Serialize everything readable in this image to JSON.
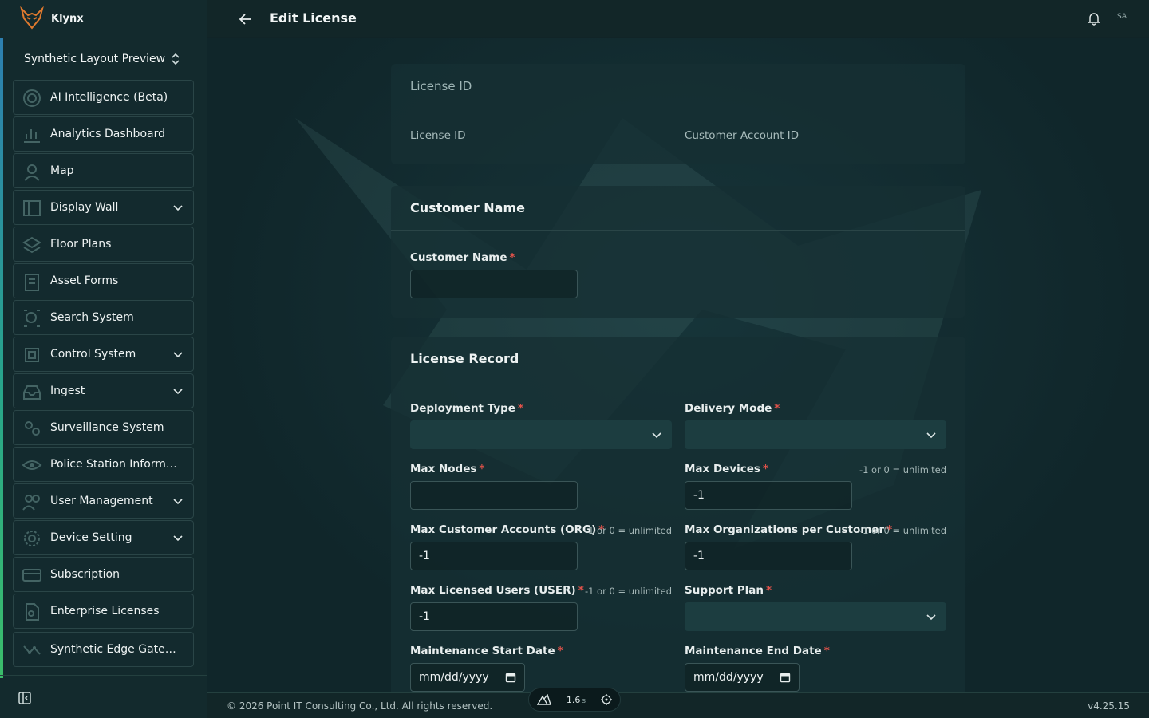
{
  "app": {
    "name": "Klynx"
  },
  "org": {
    "name": "Synthetic Layout Preview"
  },
  "sidebar": {
    "items": [
      {
        "label": "AI Intelligence (Beta)",
        "icon": "radar-icon",
        "expandable": false
      },
      {
        "label": "Analytics Dashboard",
        "icon": "chart-icon",
        "expandable": false
      },
      {
        "label": "Map",
        "icon": "map-pin-icon",
        "expandable": false
      },
      {
        "label": "Display Wall",
        "icon": "display-icon",
        "expandable": true
      },
      {
        "label": "Floor Plans",
        "icon": "layers-icon",
        "expandable": false
      },
      {
        "label": "Asset Forms",
        "icon": "clipboard-icon",
        "expandable": false
      },
      {
        "label": "Search System",
        "icon": "search-icon",
        "expandable": false
      },
      {
        "label": "Control System",
        "icon": "cpu-icon",
        "expandable": true
      },
      {
        "label": "Ingest",
        "icon": "inbox-icon",
        "expandable": true
      },
      {
        "label": "Surveillance System",
        "icon": "camera-icon",
        "expandable": false
      },
      {
        "label": "Police Station Information",
        "icon": "eye-icon",
        "expandable": false
      },
      {
        "label": "User Management",
        "icon": "users-icon",
        "expandable": true
      },
      {
        "label": "Device Setting",
        "icon": "gear-icon",
        "expandable": true
      },
      {
        "label": "Subscription",
        "icon": "card-icon",
        "expandable": false
      },
      {
        "label": "Enterprise Licenses",
        "icon": "license-icon",
        "expandable": false
      },
      {
        "label": "Synthetic Edge Gateway",
        "icon": "gateway-icon",
        "expandable": false
      }
    ]
  },
  "header": {
    "title": "Edit License",
    "user_initials": "SA"
  },
  "license_id_card": {
    "title": "License ID",
    "license_id_label": "License ID",
    "customer_account_id_label": "Customer Account ID"
  },
  "customer_card": {
    "title": "Customer Name",
    "customer_name_label": "Customer Name",
    "customer_name_value": ""
  },
  "record_card": {
    "title": "License Record",
    "deployment_type_label": "Deployment Type",
    "deployment_type_value": "",
    "delivery_mode_label": "Delivery Mode",
    "delivery_mode_value": "",
    "max_nodes_label": "Max Nodes",
    "max_nodes_value": "",
    "max_devices_label": "Max Devices",
    "max_devices_value": "-1",
    "max_devices_hint": "-1 or 0 = unlimited",
    "max_customer_accounts_label": "Max Customer Accounts (ORG)",
    "max_customer_accounts_value": "-1",
    "max_customer_accounts_hint": "-1 or 0 = unlimited",
    "max_orgs_per_customer_label": "Max Organizations per Customer",
    "max_orgs_per_customer_value": "-1",
    "max_orgs_per_customer_hint": "-1 or 0 = unlimited",
    "max_licensed_users_label": "Max Licensed Users (USER)",
    "max_licensed_users_value": "-1",
    "max_licensed_users_hint": "-1 or 0 = unlimited",
    "support_plan_label": "Support Plan",
    "support_plan_value": "",
    "maintenance_start_label": "Maintenance Start Date",
    "maintenance_start_value": "mm/dd/yyyy",
    "maintenance_end_label": "Maintenance End Date",
    "maintenance_end_value": "mm/dd/yyyy",
    "required_mark": "*"
  },
  "footer": {
    "copyright": "© 2026 Point IT Consulting Co., Ltd. All rights reserved.",
    "version": "v4.25.15",
    "devtools_time": "1.6",
    "devtools_unit": "s"
  },
  "colors": {
    "required": "#e0524a",
    "accent_gradient_top": "#2d7fb0",
    "accent_gradient_bottom": "#3bbd6a"
  }
}
